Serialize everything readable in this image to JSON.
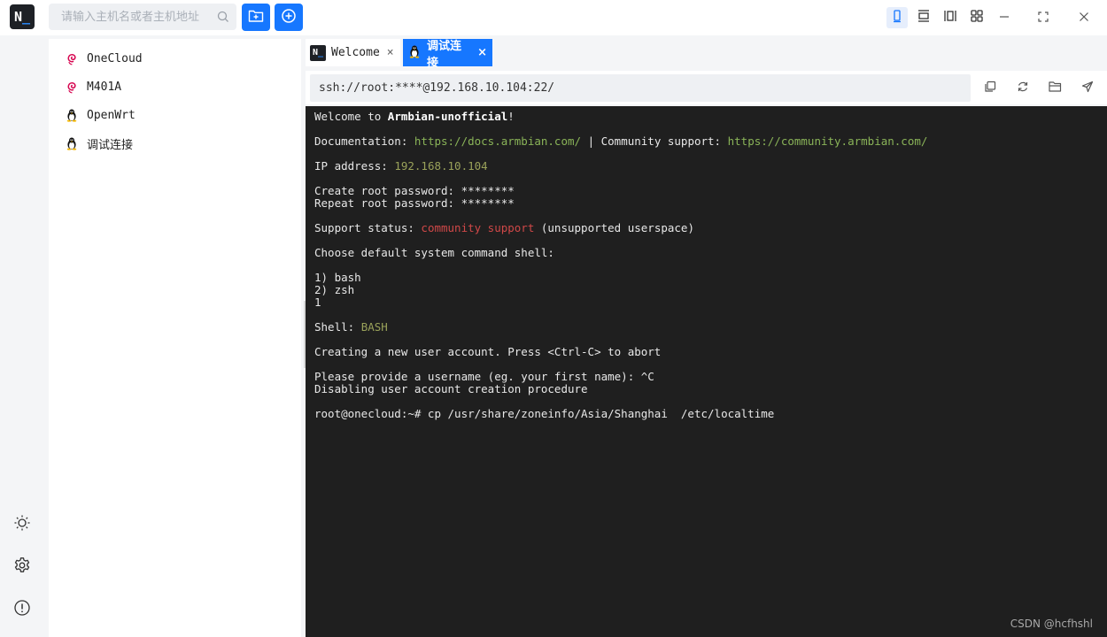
{
  "app": {
    "logo_text": "N",
    "logo_cursor": "_",
    "search_placeholder": "请输入主机名或者主机地址",
    "accent": "#1677ff"
  },
  "hosts": [
    {
      "name": "OneCloud",
      "icon": "debian-icon"
    },
    {
      "name": "M401A",
      "icon": "debian-icon"
    },
    {
      "name": "OpenWrt",
      "icon": "linux-penguin-icon"
    },
    {
      "name": "调试连接",
      "icon": "linux-penguin-icon"
    }
  ],
  "tabs": [
    {
      "label": "Welcome",
      "active": false
    },
    {
      "label": "调试连接",
      "active": true
    }
  ],
  "close_glyph": "×",
  "address": {
    "value": "ssh://root:****@192.168.10.104:22/"
  },
  "terminal": {
    "welcome_prefix": "Welcome to ",
    "welcome_name": "Armbian-unofficial",
    "welcome_suffix": "!",
    "doc_label": "Documentation: ",
    "doc_url": "https://docs.armbian.com/",
    "doc_sep": " | Community support: ",
    "community_url": "https://community.armbian.com/",
    "ip_label": "IP address: ",
    "ip_value": "192.168.10.104",
    "pw1": "Create root password: ********",
    "pw2": "Repeat root password: ********",
    "support_label": "Support status: ",
    "support_value": "community support",
    "support_suffix": " (unsupported userspace)",
    "choose_shell": "Choose default system command shell:",
    "opt1": "1) bash",
    "opt2": "2) zsh",
    "choice": "1",
    "shell_label": "Shell: ",
    "shell_value": "BASH",
    "create_user": "Creating a new user account. Press <Ctrl-C> to abort",
    "provide_username": "Please provide a username (eg. your first name): ^C",
    "disabling": "Disabling user account creation procedure",
    "prompt": "root@onecloud:~# cp /usr/share/zoneinfo/Asia/Shanghai  /etc/localtime"
  },
  "watermark": "CSDN @hcfhshl"
}
